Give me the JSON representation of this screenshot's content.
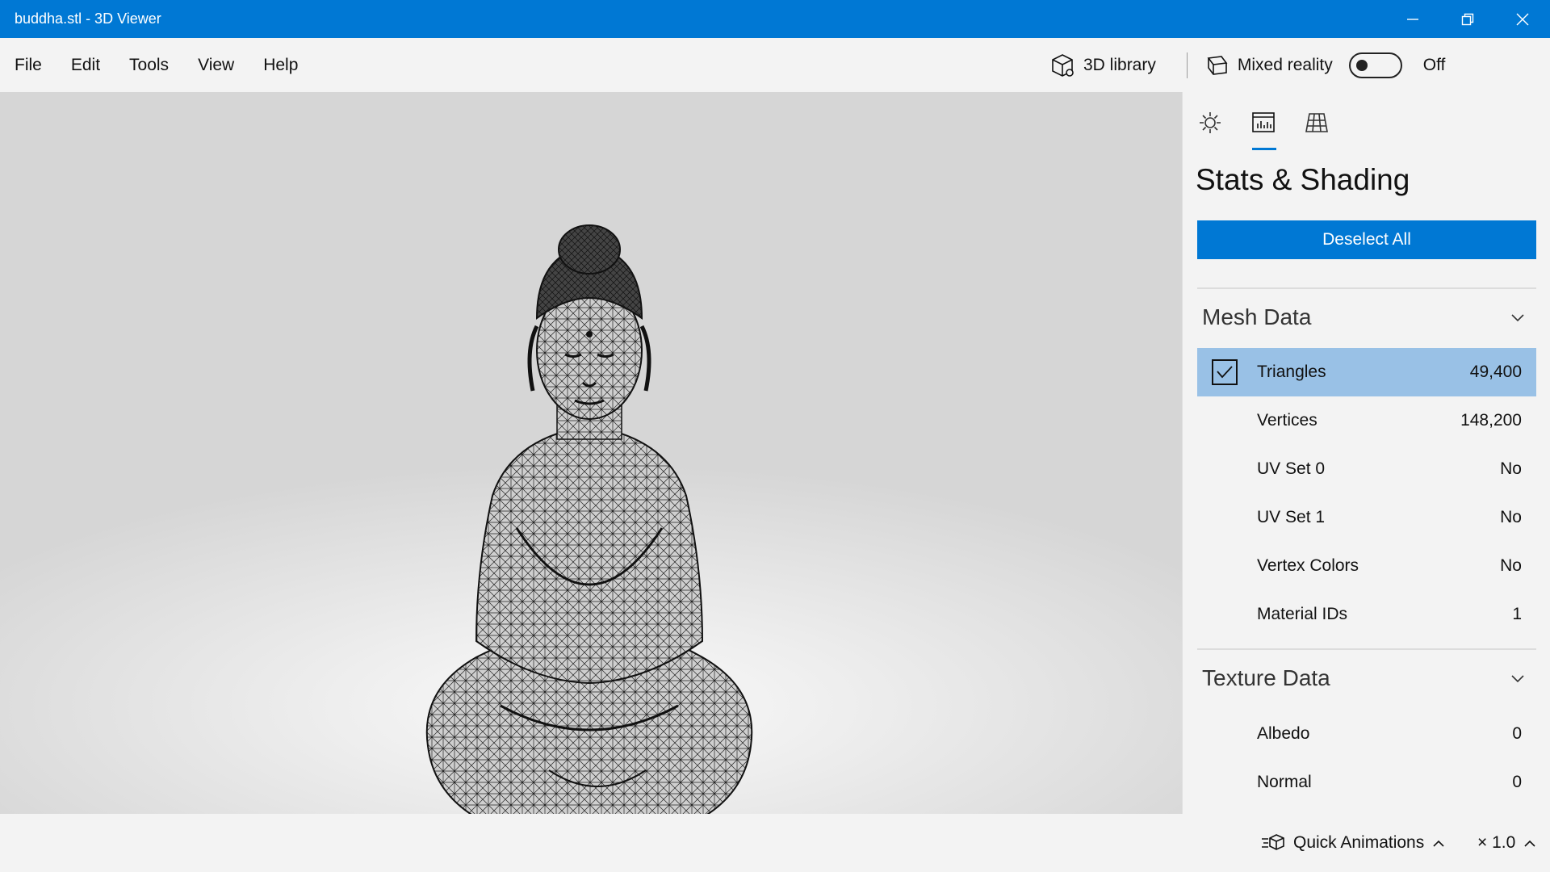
{
  "window": {
    "title": "buddha.stl - 3D Viewer"
  },
  "menu": {
    "items": [
      "File",
      "Edit",
      "Tools",
      "View",
      "Help"
    ]
  },
  "toolbar": {
    "library_label": "3D library",
    "mixed_reality_label": "Mixed reality",
    "mixed_reality_state": "Off"
  },
  "panel": {
    "tabs": [
      "lighting-icon",
      "stats-icon",
      "grid-icon"
    ],
    "title": "Stats & Shading",
    "deselect_label": "Deselect All",
    "mesh": {
      "title": "Mesh Data",
      "rows": [
        {
          "label": "Triangles",
          "value": "49,400",
          "checked": true
        },
        {
          "label": "Vertices",
          "value": "148,200"
        },
        {
          "label": "UV Set 0",
          "value": "No"
        },
        {
          "label": "UV Set 1",
          "value": "No"
        },
        {
          "label": "Vertex Colors",
          "value": "No"
        },
        {
          "label": "Material IDs",
          "value": "1"
        }
      ]
    },
    "texture": {
      "title": "Texture Data",
      "rows": [
        {
          "label": "Albedo",
          "value": "0"
        },
        {
          "label": "Normal",
          "value": "0"
        }
      ]
    }
  },
  "bottom": {
    "animations_label": "Quick Animations",
    "speed_label": "× 1.0"
  },
  "colors": {
    "accent": "#0078d4",
    "selected_row": "#99c1e6"
  }
}
